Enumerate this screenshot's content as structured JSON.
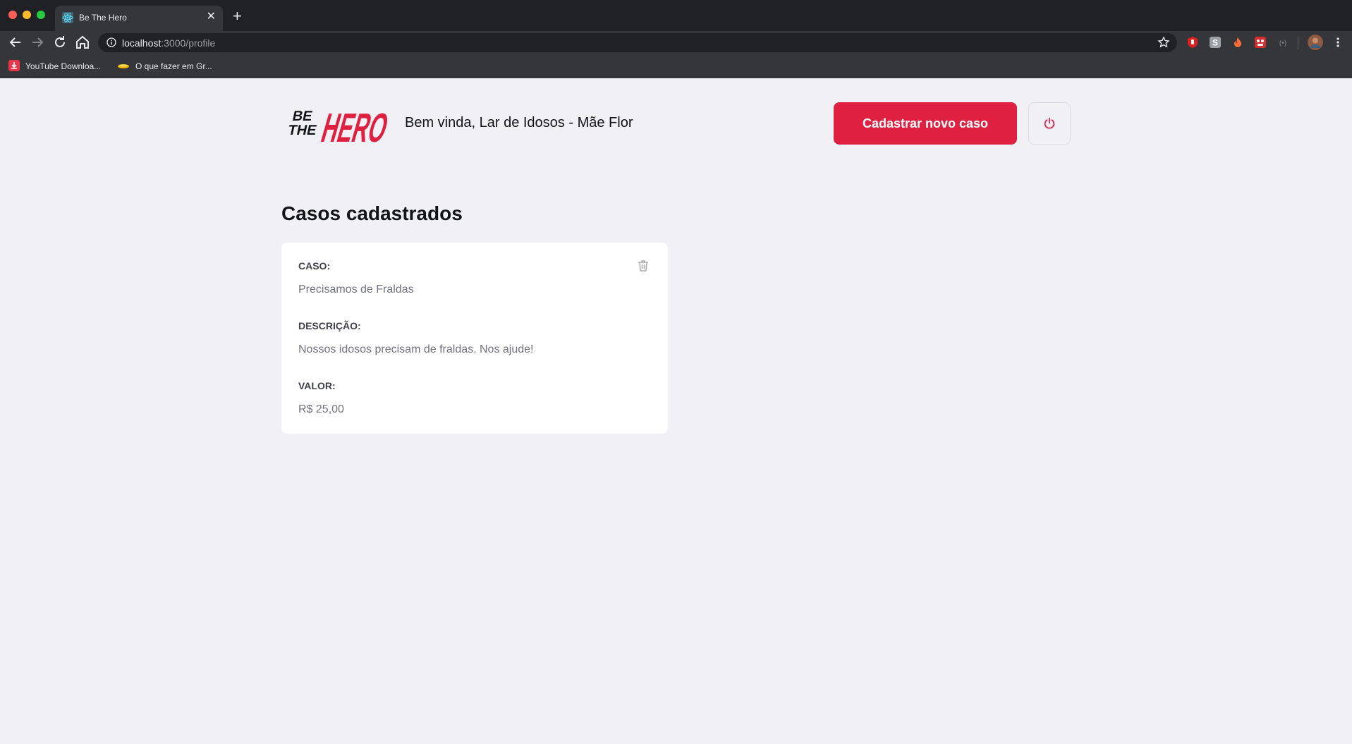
{
  "browser": {
    "tab_title": "Be The Hero",
    "url_host": "localhost",
    "url_path": ":3000/profile",
    "new_tab_symbol": "+",
    "close_symbol": "✕",
    "bookmarks": [
      {
        "label": "YouTube Downloa...",
        "icon": "download-icon"
      },
      {
        "label": "O que fazer em Gr...",
        "icon": "bookmark-favicon"
      }
    ],
    "extension_icons": [
      "shield-extension-icon",
      "s-extension-icon",
      "fire-extension-icon",
      "red-extension-icon",
      "grey-extension-icon",
      "profile-avatar"
    ]
  },
  "header": {
    "logo_text": [
      "BE",
      "THE",
      "HERO"
    ],
    "welcome": "Bem vinda, Lar de Idosos - Mãe Flor",
    "new_case_label": "Cadastrar novo caso",
    "logout_icon": "power-icon"
  },
  "main": {
    "title": "Casos cadastrados",
    "cases": [
      {
        "case_label": "CASO:",
        "case_value": "Precisamos de Fraldas",
        "description_label": "DESCRIÇÃO:",
        "description_value": "Nossos idosos precisam de fraldas. Nos ajude!",
        "value_label": "VALOR:",
        "value_value": "R$ 25,00",
        "delete_icon": "trash-icon"
      }
    ]
  },
  "colors": {
    "brand": "#e02041",
    "background": "#f0f0f5",
    "text_dark": "#13131a",
    "text_label": "#41414d",
    "text_value": "#737380"
  }
}
